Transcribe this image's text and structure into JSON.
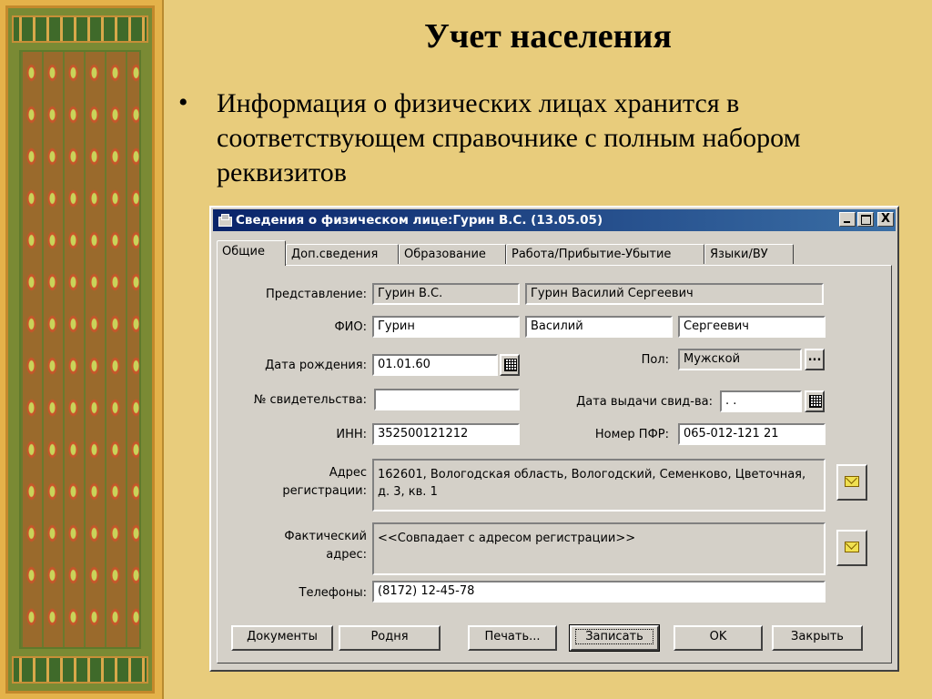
{
  "slide": {
    "title": "Учет населения",
    "bullet_marker": "•",
    "bullet_text": "Информация о физических лицах хранится в соответствующем справочнике с полным набором реквизитов"
  },
  "window": {
    "title": "Сведения о физическом лице:Гурин В.С. (13.05.05)",
    "controls": {
      "close": "X"
    }
  },
  "tabs": [
    {
      "label": "Общие",
      "active": true
    },
    {
      "label": "Доп.сведения",
      "active": false
    },
    {
      "label": "Образование",
      "active": false
    },
    {
      "label": "Работа/Прибытие-Убытие",
      "active": false
    },
    {
      "label": "Языки/ВУ",
      "active": false
    }
  ],
  "form": {
    "representation": {
      "label": "Представление:",
      "short": "Гурин В.С.",
      "full": "Гурин Василий Сергеевич"
    },
    "fio": {
      "label": "ФИО:",
      "last": "Гурин",
      "first": "Василий",
      "middle": "Сергеевич"
    },
    "birth_date": {
      "label": "Дата рождения:",
      "value": "01.01.60"
    },
    "sex": {
      "label": "Пол:",
      "value": "Мужской",
      "button": "..."
    },
    "certificate": {
      "label": "№ свидетельства:",
      "value": ""
    },
    "cert_date": {
      "label": "Дата выдачи свид-ва:",
      "value": " .  . "
    },
    "inn": {
      "label": "ИНН:",
      "value": "352500121212"
    },
    "pfr": {
      "label": "Номер ПФР:",
      "value": "065-012-121 21"
    },
    "reg_address": {
      "label_1": "Адрес",
      "label_2": "регистрации:",
      "value": "162601, Вологодская область, Вологодский, Семенково, Цветочная, д. 3, кв. 1"
    },
    "actual_address": {
      "label_1": "Фактический",
      "label_2": "адрес:",
      "value": "<<Совпадает с адресом регистрации>>"
    },
    "phones": {
      "label": "Телефоны:",
      "value": "(8172) 12-45-78"
    }
  },
  "buttons": {
    "documents": "Документы",
    "relatives": "Родня",
    "print": "Печать...",
    "save": "Записать",
    "ok": "OK",
    "close": "Закрыть"
  },
  "colors": {
    "slide_bg": "#e8cc7c",
    "titlebar_start": "#0a246a",
    "titlebar_end": "#3a6ea5",
    "dialog_face": "#d4d0c8"
  }
}
